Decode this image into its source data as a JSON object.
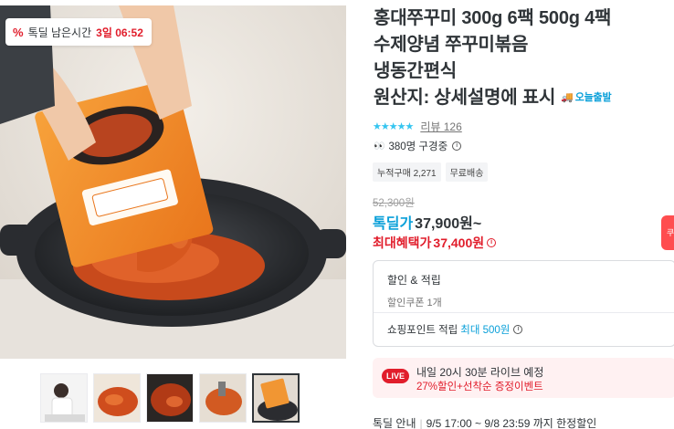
{
  "deal_badge": {
    "icon": "percent-icon",
    "label": "톡딜 남은시간",
    "time": "3일 06:52"
  },
  "product": {
    "title_lines": [
      "홍대쭈꾸미 300g 6팩 500g 4팩",
      "수제양념 쭈꾸미볶음",
      "냉동간편식",
      "원산지: 상세설명에 표시"
    ],
    "delivery_tag": "오늘출발",
    "review_label": "리뷰 126",
    "viewers": "380명 구경중",
    "chips": [
      "누적구매 2,271",
      "무료배송"
    ]
  },
  "price": {
    "original": "52,300원",
    "deal_label": "톡딜가",
    "deal_value": "37,900원~",
    "max_label": "최대혜택가",
    "max_value": "37,400원"
  },
  "side_tab": "쿠",
  "benefits": {
    "head": "할인 & 적립",
    "coupon": "할인쿠폰 1개",
    "points_label": "쇼핑포인트 적립",
    "points_max": "최대 500원"
  },
  "live": {
    "badge": "LIVE",
    "title": "내일 20시 30분 라이브 예정",
    "sub": "27%할인+선착순 증정이벤트"
  },
  "notice": {
    "label": "톡딜 안내",
    "text": "9/5 17:00 ~ 9/8 23:59 까지 한정할인"
  },
  "thumbnails": [
    "thumb-person",
    "thumb-dish-1",
    "thumb-dish-2",
    "thumb-dish-3",
    "thumb-pack-active"
  ],
  "colors": {
    "accent": "#35c5f0",
    "sale_red": "#e11d2b"
  }
}
